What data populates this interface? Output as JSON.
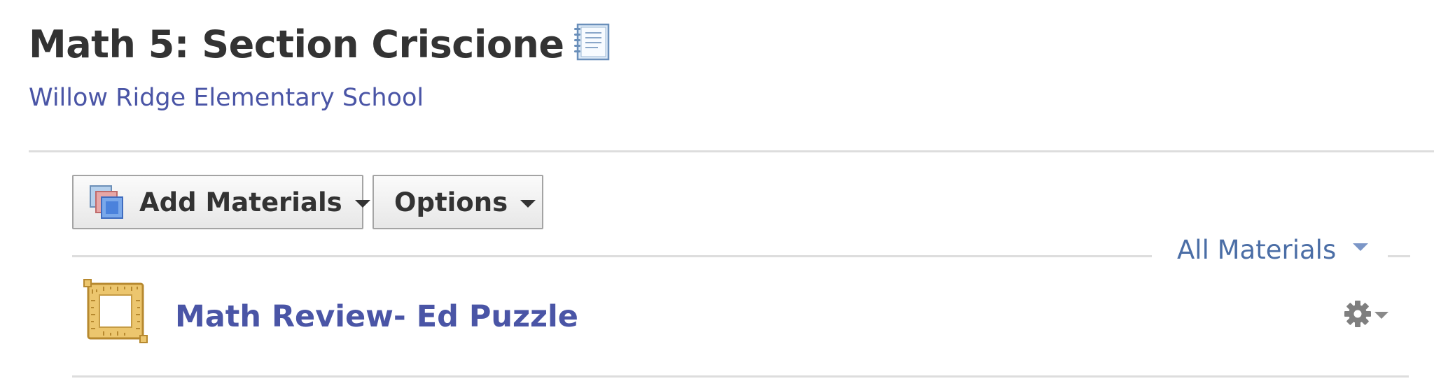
{
  "header": {
    "title": "Math 5: Section Criscione",
    "title_icon": "notebook-icon",
    "school_link": "Willow Ridge Elementary School"
  },
  "toolbar": {
    "add_materials_label": "Add Materials",
    "add_materials_icon": "add-materials-icon",
    "options_label": "Options"
  },
  "filter": {
    "selected": "All Materials"
  },
  "materials": [
    {
      "icon": "puzzle-frame-icon",
      "title": "Math Review- Ed Puzzle",
      "actions_icon": "gear-icon"
    }
  ],
  "colors": {
    "link": "#4a55a6",
    "filter": "#4b6ea6",
    "title": "#333333",
    "divider": "#dddddd"
  }
}
